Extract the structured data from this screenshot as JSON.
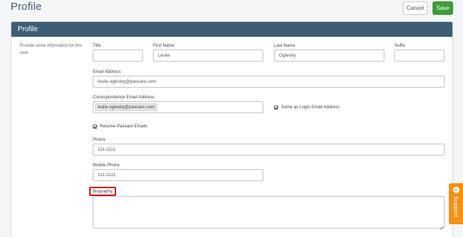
{
  "header": {
    "title": "Profile",
    "cancel_label": "Cancel",
    "save_label": "Save"
  },
  "card": {
    "title": "Profile",
    "description": "Provide some information for this user."
  },
  "fields": {
    "title": {
      "label": "Title",
      "value": ""
    },
    "first_name": {
      "label": "First Name",
      "value": "Leslie"
    },
    "last_name": {
      "label": "Last Name",
      "value": "Oglesby"
    },
    "suffix": {
      "label": "Suffix",
      "value": ""
    },
    "email": {
      "label": "Email Address",
      "value": "leslie.oglesby@passare.com"
    },
    "correspondence_email": {
      "label": "Correspondence Email Address",
      "value": "leslie.oglesby@passare.com"
    },
    "same_as_login": {
      "label": "Same as Login Email Address",
      "checked": true
    },
    "receive_emails": {
      "label": "Receive Passare Emails",
      "checked": true
    },
    "phone": {
      "label": "Phone",
      "value": "111-1111"
    },
    "mobile_phone": {
      "label": "Mobile Phone",
      "value": "111-1111"
    },
    "biography": {
      "label": "Biography",
      "value": ""
    }
  },
  "support": {
    "label": "Support",
    "icon": "chat-bubble-icon"
  },
  "colors": {
    "header_bar": "#3d5e75",
    "save_button": "#3e9d36",
    "support_tab": "#f29115",
    "highlight": "#d0101a"
  }
}
